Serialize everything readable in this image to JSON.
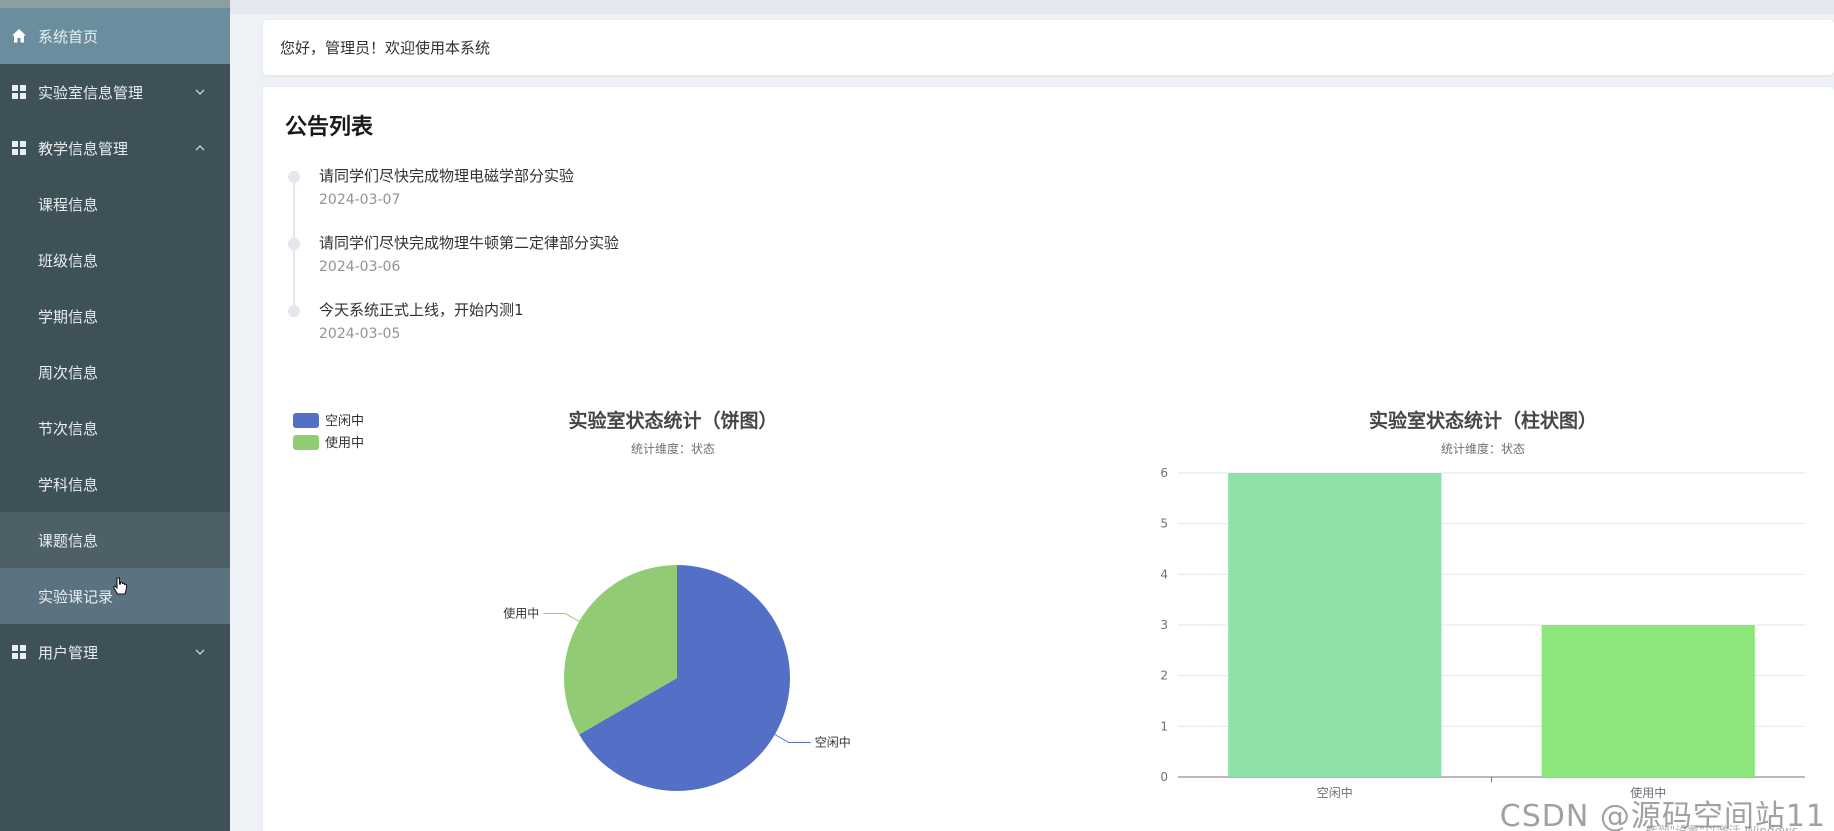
{
  "sidebar": {
    "items": [
      {
        "label": "系统首页",
        "icon": "home-icon",
        "type": "top",
        "state": "active-home"
      },
      {
        "label": "实验室信息管理",
        "icon": "grid-icon",
        "type": "top",
        "chevron": "down"
      },
      {
        "label": "教学信息管理",
        "icon": "grid-icon",
        "type": "top",
        "chevron": "up"
      },
      {
        "label": "课程信息",
        "type": "sub"
      },
      {
        "label": "班级信息",
        "type": "sub"
      },
      {
        "label": "学期信息",
        "type": "sub"
      },
      {
        "label": "周次信息",
        "type": "sub"
      },
      {
        "label": "节次信息",
        "type": "sub"
      },
      {
        "label": "学科信息",
        "type": "sub"
      },
      {
        "label": "课题信息",
        "type": "sub",
        "state": "hover"
      },
      {
        "label": "实验课记录",
        "type": "sub",
        "state": "selected"
      },
      {
        "label": "用户管理",
        "icon": "grid-icon",
        "type": "top",
        "chevron": "down"
      }
    ]
  },
  "welcome": {
    "text": "您好，管理员！欢迎使用本系统"
  },
  "notices": {
    "title": "公告列表",
    "items": [
      {
        "text": "请同学们尽快完成物理电磁学部分实验",
        "date": "2024-03-07"
      },
      {
        "text": "请同学们尽快完成物理牛顿第二定律部分实验",
        "date": "2024-03-06"
      },
      {
        "text": "今天系统正式上线，开始内测1",
        "date": "2024-03-05"
      }
    ]
  },
  "chart_data": [
    {
      "type": "pie",
      "title": "实验室状态统计（饼图）",
      "subtitle": "统计维度：状态",
      "legend_position": "top-left",
      "slices": [
        {
          "name": "空闲中",
          "value": 6,
          "color": "#5470c6"
        },
        {
          "name": "使用中",
          "value": 3,
          "color": "#91cc75"
        }
      ]
    },
    {
      "type": "bar",
      "title": "实验室状态统计（柱状图）",
      "subtitle": "统计维度：状态",
      "categories": [
        "空闲中",
        "使用中"
      ],
      "values": [
        6,
        3
      ],
      "colors": [
        "#8fdfa9",
        "#8ce67a"
      ],
      "ylim": [
        0,
        6
      ],
      "yticks": [
        0,
        1,
        2,
        3,
        4,
        5,
        6
      ],
      "grid": true
    }
  ],
  "watermark": {
    "text": "CSDN @源码空间站11",
    "activate_text": "转到\"设置\"以激活 Windows。"
  },
  "colors": {
    "sidebar_bg": "#3f5158",
    "active_home": "#6b8e9f"
  }
}
